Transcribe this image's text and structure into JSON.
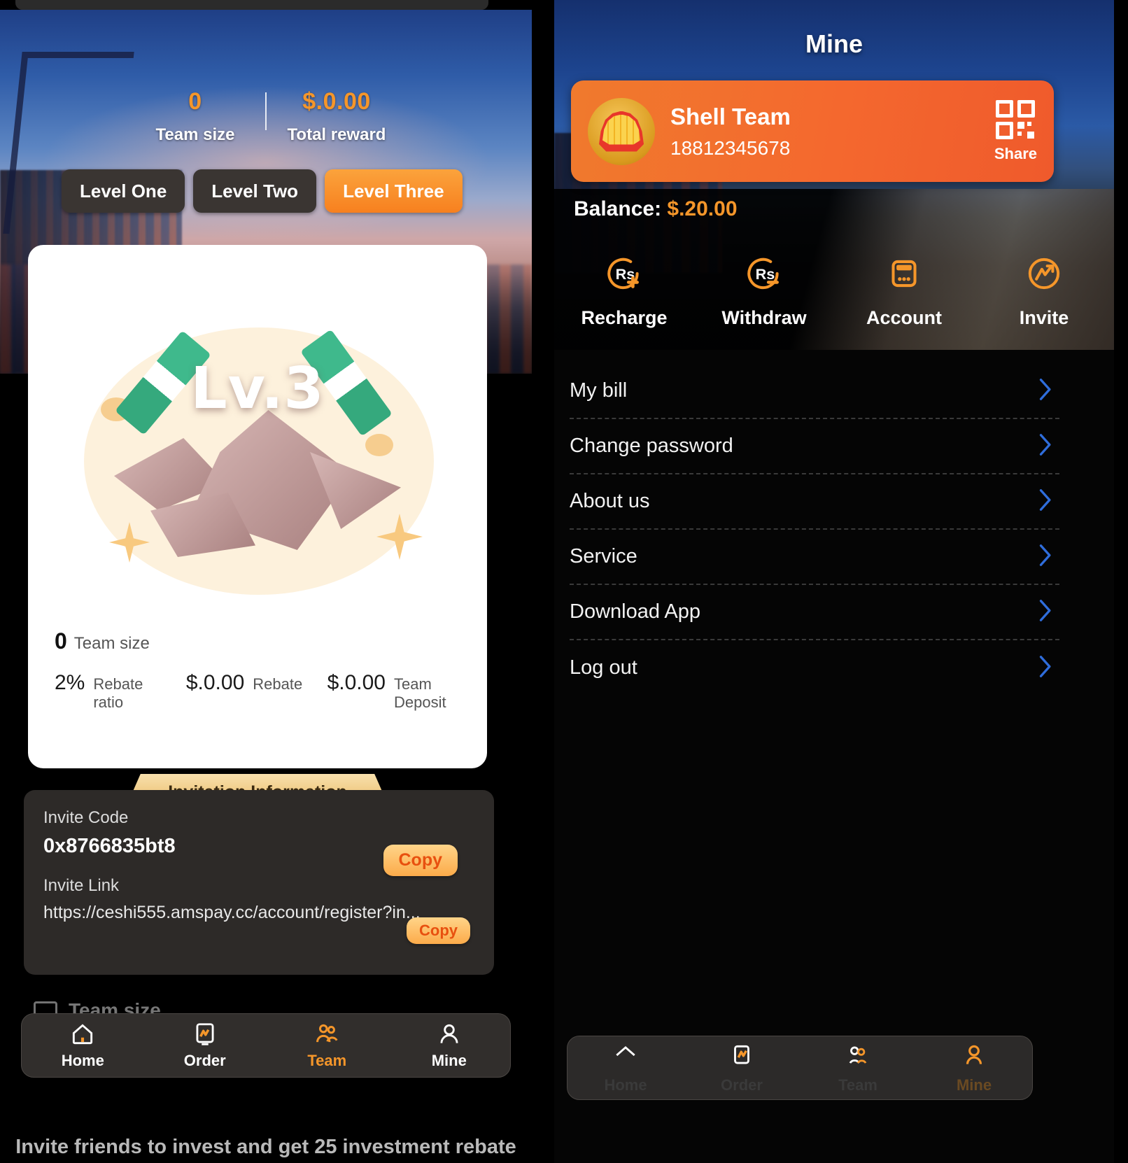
{
  "left_screen": {
    "hero": {
      "stats": [
        {
          "value": "0",
          "label": "Team size"
        },
        {
          "value": "$.0.00",
          "label": "Total reward"
        }
      ],
      "levels": [
        {
          "label": "Level One",
          "active": false
        },
        {
          "label": "Level Two",
          "active": false
        },
        {
          "label": "Level Three",
          "active": true
        }
      ]
    },
    "level_card": {
      "badge_text": "Lv.3",
      "team_size_value": "0",
      "team_size_label": "Team size",
      "metrics": [
        {
          "value": "2%",
          "label": "Rebate ratio"
        },
        {
          "value": "$.0.00",
          "label": "Rebate"
        },
        {
          "value": "$.0.00",
          "label": "Team Deposit"
        }
      ]
    },
    "invitation": {
      "tab_title": "Invitation Information",
      "invite_code_label": "Invite Code",
      "invite_code_value": "0x8766835bt8",
      "invite_code_copy": "Copy",
      "invite_link_label": "Invite Link",
      "invite_link_value": "https://ceshi555.amspay.cc/account/register?in...",
      "invite_link_copy": "Copy"
    },
    "partial_row_label": "Team size",
    "tabbar": [
      {
        "label": "Home",
        "icon": "home-icon",
        "active": false
      },
      {
        "label": "Order",
        "icon": "order-chart-icon",
        "active": false
      },
      {
        "label": "Team",
        "icon": "team-people-icon",
        "active": true
      },
      {
        "label": "Mine",
        "icon": "person-icon",
        "active": false
      }
    ],
    "footer_note": "Invite friends to invest and get 25 investment rebate"
  },
  "right_screen": {
    "title": "Mine",
    "profile": {
      "avatar_icon": "shell-logo-icon",
      "name": "Shell Team",
      "phone": "18812345678",
      "qr_icon": "qr-code-icon",
      "share_label": "Share"
    },
    "balance_label": "Balance:",
    "balance_value": "$.20.00",
    "actions": [
      {
        "label": "Recharge",
        "icon": "rupee-plus-icon"
      },
      {
        "label": "Withdraw",
        "icon": "rupee-minus-icon"
      },
      {
        "label": "Account",
        "icon": "card-icon"
      },
      {
        "label": "Invite",
        "icon": "trend-circle-icon"
      }
    ],
    "menu": [
      {
        "label": "My bill",
        "icon": "chevron-right-icon"
      },
      {
        "label": "Change password",
        "icon": "chevron-right-icon"
      },
      {
        "label": "About us",
        "icon": "chevron-right-icon"
      },
      {
        "label": "Service",
        "icon": "chevron-right-icon"
      },
      {
        "label": "Download App",
        "icon": "chevron-right-icon"
      },
      {
        "label": "Log out",
        "icon": "chevron-right-icon"
      }
    ],
    "tabbar": [
      {
        "label": "Home",
        "icon": "home-icon",
        "active": false
      },
      {
        "label": "Order",
        "icon": "order-chart-icon",
        "active": false
      },
      {
        "label": "Team",
        "icon": "team-people-icon",
        "active": false
      },
      {
        "label": "Mine",
        "icon": "person-icon",
        "active": true
      }
    ]
  },
  "colors": {
    "accent_orange": "#f5962a",
    "card_orange": "#f4682e",
    "chevron_blue": "#2f6ddb",
    "dark_bg": "#000000",
    "panel_dark": "#2d2a28"
  }
}
